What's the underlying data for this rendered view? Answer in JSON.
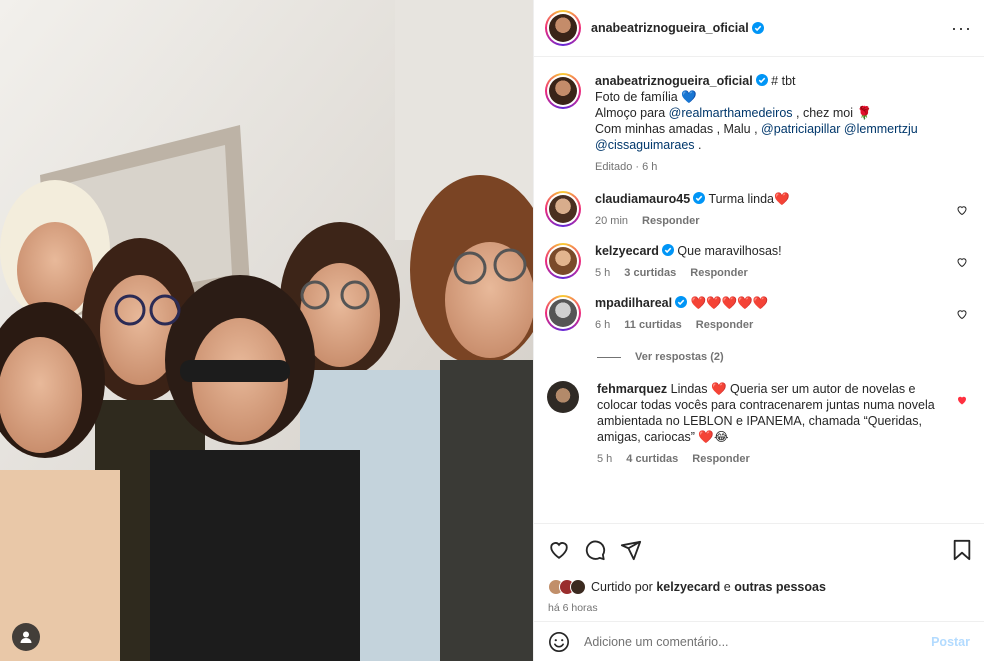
{
  "post": {
    "username": "anabeatriznogueira_oficial",
    "more_label": "···"
  },
  "caption": {
    "username": "anabeatriznogueira_oficial",
    "line1": "# tbt",
    "line2_text": "Foto de família",
    "line2_emoji": "💙",
    "line3_prefix": "Almoço para",
    "line3_mention": "@realmarthamedeiros",
    "line3_suffix": ", chez moi",
    "line3_emoji": "🌹",
    "line4_prefix": "Com minhas amadas , Malu ,",
    "line4_mention1": "@patriciapillar",
    "line4_mention2": "@lemmertzju",
    "line5_mention": "@cissaguimaraes",
    "line5_suffix": ".",
    "meta": "Editado · 6 h"
  },
  "comments": [
    {
      "username": "claudiamauro45",
      "text": "Turma linda❤️",
      "time": "20 min",
      "likes": "",
      "reply": "Responder"
    },
    {
      "username": "kelzyecard",
      "text": "Que maravilhosas!",
      "time": "5 h",
      "likes": "3 curtidas",
      "reply": "Responder"
    },
    {
      "username": "mpadilhareal",
      "text": "❤️❤️❤️❤️❤️",
      "time": "6 h",
      "likes": "11 curtidas",
      "reply": "Responder",
      "view_replies": "Ver respostas (2)"
    },
    {
      "username": "fehmarquez",
      "text": "Lindas ❤️ Queria ser um autor de novelas e colocar todas vocês para contracenarem juntas numa novela ambientada no LEBLON e IPANEMA, chamada “Queridas, amigas, cariocas” ❤️😂",
      "time": "5 h",
      "likes": "4 curtidas",
      "reply": "Responder"
    }
  ],
  "likes": {
    "prefix": "Curtido por",
    "user": "kelzyecard",
    "connector": "e",
    "others": "outras pessoas"
  },
  "timestamp": "há 6 horas",
  "add_comment": {
    "placeholder": "Adicione um comentário...",
    "post_label": "Postar"
  },
  "colors": {
    "verified": "#0095f6",
    "heart_liked": "#ff3040",
    "link": "#00376b",
    "post_disabled": "#b3dbff"
  }
}
